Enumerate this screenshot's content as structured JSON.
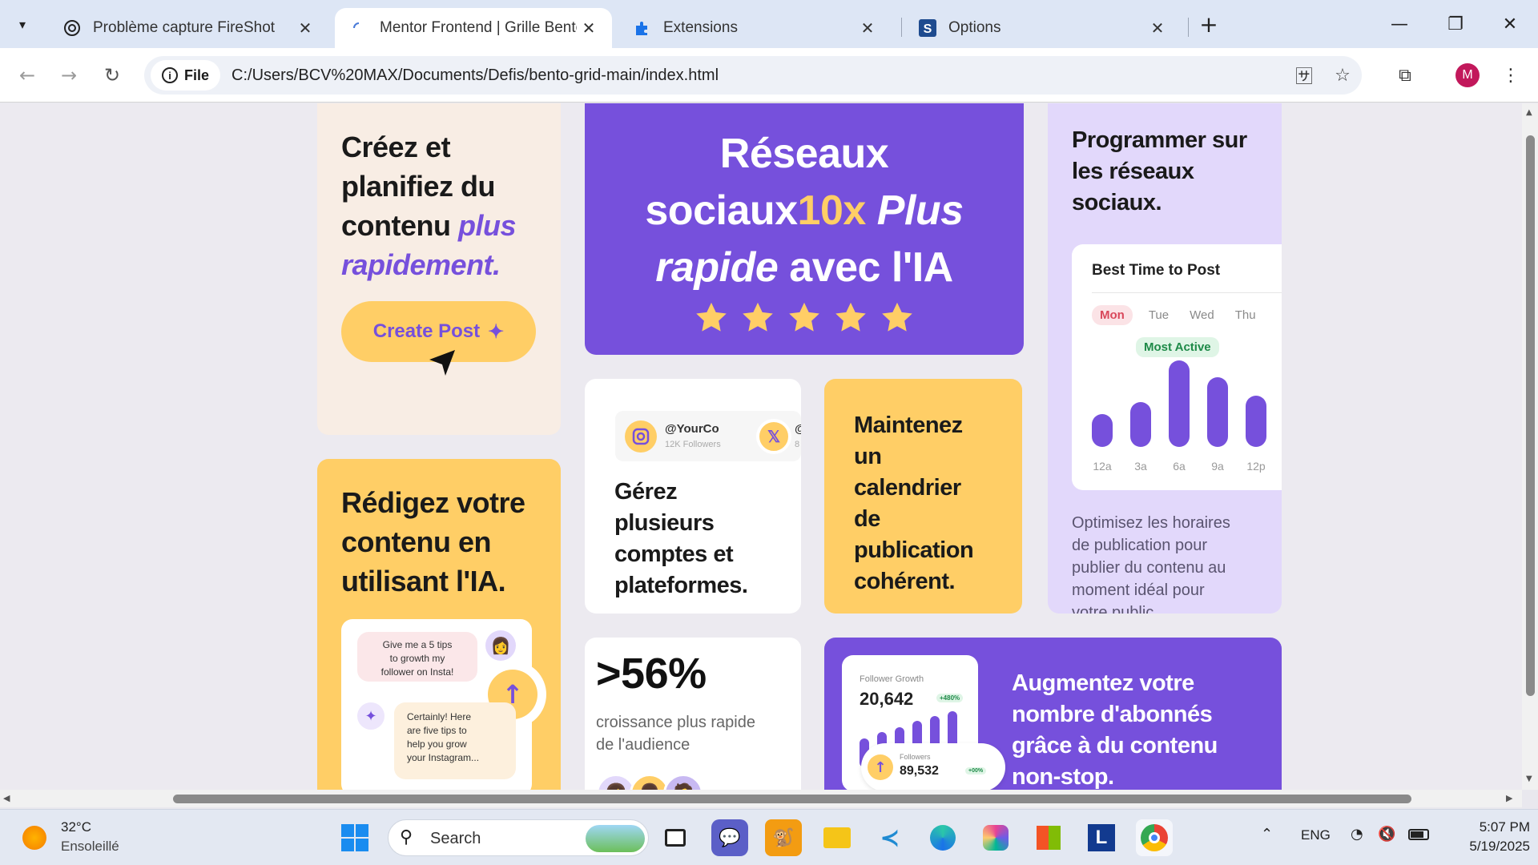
{
  "browser": {
    "tabs": [
      {
        "title": "Problème capture FireShot",
        "active": false
      },
      {
        "title": "Mentor Frontend | Grille Bento",
        "active": true
      },
      {
        "title": "Extensions",
        "active": false
      },
      {
        "title": "Options",
        "active": false
      }
    ],
    "chip_label": "File",
    "url": "C:/Users/BCV%20MAX/Documents/Defis/bento-grid-main/index.html",
    "profile_initial": "M"
  },
  "page": {
    "card_create": {
      "line1": "Créez et",
      "line2": "planifiez du",
      "line3": "contenu",
      "accent1": "plus",
      "accent2": "rapidement.",
      "button": "Create Post"
    },
    "card_hero": {
      "line1": "Réseaux",
      "line2a": "sociaux",
      "line2b": "10x",
      "line2c": "Plus",
      "line3a": "rapide",
      "line3b": "avec l'IA",
      "rating": 5
    },
    "card_schedule": {
      "title_l1": "Programmer sur",
      "title_l2": "les réseaux",
      "title_l3": "sociaux.",
      "widget_title": "Best Time to Post",
      "days": [
        "Mon",
        "Tue",
        "Wed",
        "Thu"
      ],
      "badge": "Most Active",
      "bars": [
        {
          "label": "12a",
          "value": 0.38
        },
        {
          "label": "3a",
          "value": 0.52
        },
        {
          "label": "6a",
          "value": 1.0
        },
        {
          "label": "9a",
          "value": 0.81
        },
        {
          "label": "12p",
          "value": 0.59
        }
      ],
      "body_l1": "Optimisez les horaires",
      "body_l2": "de publication pour",
      "body_l3": "publier du contenu au",
      "body_l4": "moment idéal pour",
      "body_l5": "votre public."
    },
    "card_accounts": {
      "handle": "@YourCo",
      "followers": "12K Followers",
      "handle2_partial": "@",
      "followers2_partial": "8",
      "l1": "Gérez",
      "l2": "plusieurs",
      "l3": "comptes et",
      "l4": "plateformes."
    },
    "card_calendar": {
      "l1": "Maintenez",
      "l2": "un",
      "l3": "calendrier",
      "l4": "de",
      "l5": "publication",
      "l6": "cohérent."
    },
    "card_ai": {
      "l1": "Rédigez votre",
      "l2": "contenu en",
      "l3": "utilisant l'IA.",
      "prompt_l1": "Give me a 5 tips",
      "prompt_l2": "to growth my",
      "prompt_l3": "follower on Insta!",
      "reply_l1": "Certainly! Here",
      "reply_l2": "are five tips to",
      "reply_l3": "help you grow",
      "reply_l4": "your Instagram..."
    },
    "card_growth": {
      "stat": ">56%",
      "l1": "croissance plus rapide",
      "l2": "de l'audience"
    },
    "card_followers": {
      "widget_title": "Follower Growth",
      "count": "20,642",
      "count_delta": "+480%",
      "followers_label": "Followers",
      "followers_count": "89,532",
      "followers_delta": "+00%",
      "l1": "Augmentez votre",
      "l2": "nombre d'abonnés",
      "l3": "grâce à du contenu",
      "l4": "non-stop."
    }
  },
  "colors": {
    "purple": "#7650dc",
    "yellow": "#ffce66",
    "cream": "#f8ede4",
    "lilac": "#e2d8fb",
    "white": "#ffffff"
  },
  "taskbar": {
    "temp": "32°C",
    "weather": "Ensoleillé",
    "search_placeholder": "Search",
    "lang": "ENG",
    "time": "5:07 PM",
    "date": "5/19/2025"
  }
}
